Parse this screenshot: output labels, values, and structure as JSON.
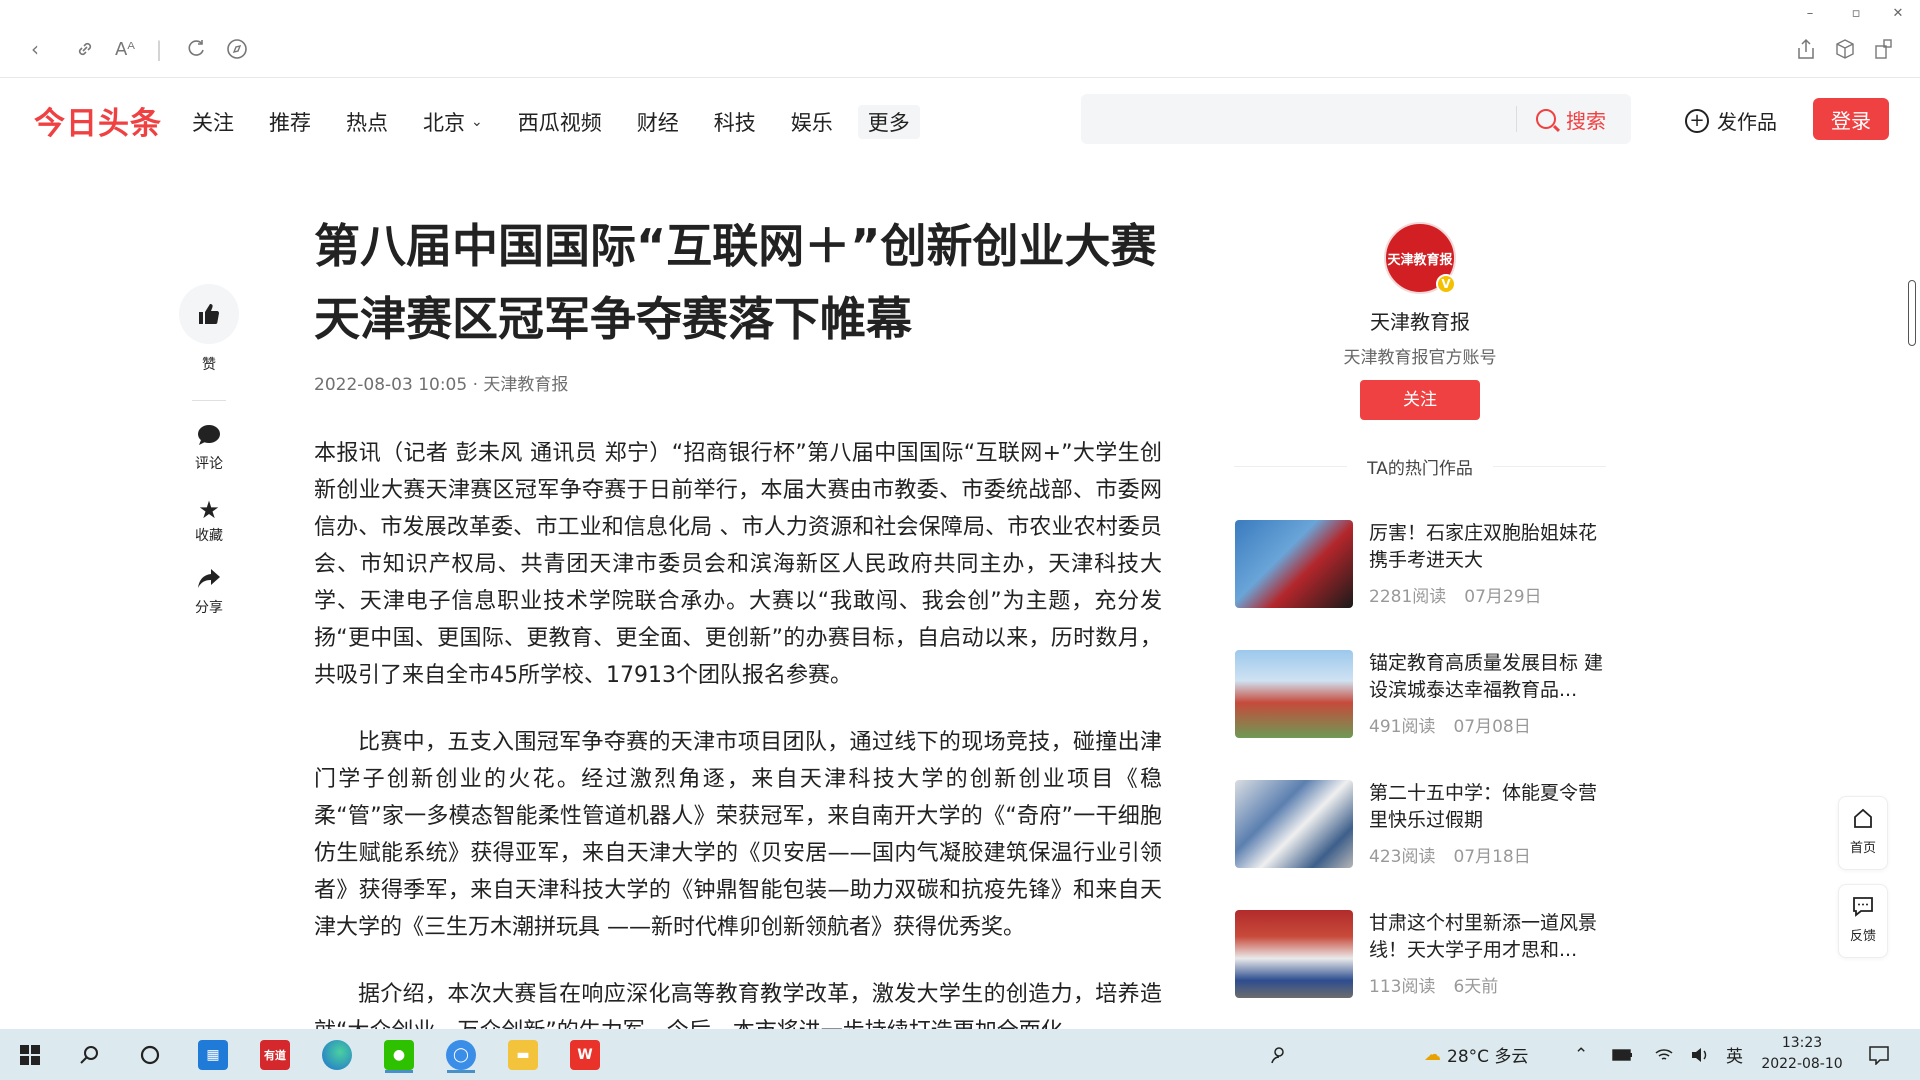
{
  "window": {
    "minimize": "–",
    "restore": "▫",
    "close": "✕"
  },
  "site": {
    "logo": "今日头条",
    "nav": [
      "关注",
      "推荐",
      "热点",
      "北京",
      "西瓜视频",
      "财经",
      "科技",
      "娱乐"
    ],
    "nav_more": "更多",
    "search_placeholder": "",
    "search_button": "搜索",
    "publish": "发作品",
    "login": "登录"
  },
  "rail": {
    "like": "赞",
    "comment": "评论",
    "favorite": "收藏",
    "share": "分享"
  },
  "article": {
    "title_line1": "第八届中国国际“互联网＋”创新创业大赛",
    "title_line2": "天津赛区冠军争夺赛落下帷幕",
    "meta": "2022-08-03 10:05 · 天津教育报",
    "paragraphs": [
      "本报讯（记者 彭未风 通讯员 郑宁）“招商银行杯”第八届中国国际“互联网+”大学生创新创业大赛天津赛区冠军争夺赛于日前举行，本届大赛由市教委、市委统战部、市委网信办、市发展改革委、市工业和信息化局 、市人力资源和社会保障局、市农业农村委员会、市知识产权局、共青团天津市委员会和滨海新区人民政府共同主办，天津科技大学、天津电子信息职业技术学院联合承办。大赛以“我敢闯、我会创”为主题，充分发扬“更中国、更国际、更教育、更全面、更创新”的办赛目标，自启动以来，历时数月，共吸引了来自全市45所学校、17913个团队报名参赛。",
      "比赛中，五支入围冠军争夺赛的天津市项目团队，通过线下的现场竞技，碰撞出津门学子创新创业的火花。经过激烈角逐，来自天津科技大学的创新创业项目《稳柔“管”家一多模态智能柔性管道机器人》荣获冠军，来自南开大学的《“奇府”一干细胞仿生赋能系统》获得亚军，来自天津大学的《贝安居——国内气凝胶建筑保温行业引领者》获得季军，来自天津科技大学的《钟鼎智能包装—助力双碳和抗疫先锋》和来自天津大学的《三生万木潮拼玩具 ——新时代榫卯创新领航者》获得优秀奖。",
      "据介绍，本次大赛旨在响应深化高等教育教学改革，激发大学生的创造力，培养造就“大众创业、万众创新”的生力军。今后，本市将进一步持续打造更加全面化"
    ]
  },
  "author": {
    "avatar_text": "天津教育报",
    "verified": "V",
    "name": "天津教育报",
    "desc": "天津教育报官方账号",
    "follow": "关注",
    "hot_title": "TA的热门作品"
  },
  "hot_items": [
    {
      "title": "厉害！石家庄双胞胎姐妹花携手考进天大",
      "reads": "2281阅读",
      "date": "07月29日"
    },
    {
      "title": "锚定教育高质量发展目标 建设滨城泰达幸福教育品...",
      "reads": "491阅读",
      "date": "07月08日"
    },
    {
      "title": "第二十五中学：体能夏令营里快乐过假期",
      "reads": "423阅读",
      "date": "07月18日"
    },
    {
      "title": "甘肃这个村里新添一道风景线！天大学子用才思和...",
      "reads": "113阅读",
      "date": "6天前"
    }
  ],
  "float_tools": {
    "home": "首页",
    "feedback": "反馈"
  },
  "taskbar": {
    "weather": "28°C 多云",
    "ime": "英",
    "time": "13:23",
    "date": "2022-08-10",
    "app_labels": [
      "有道"
    ]
  },
  "colors": {
    "brand": "#f04142",
    "taskbar": "#dce9ee"
  }
}
